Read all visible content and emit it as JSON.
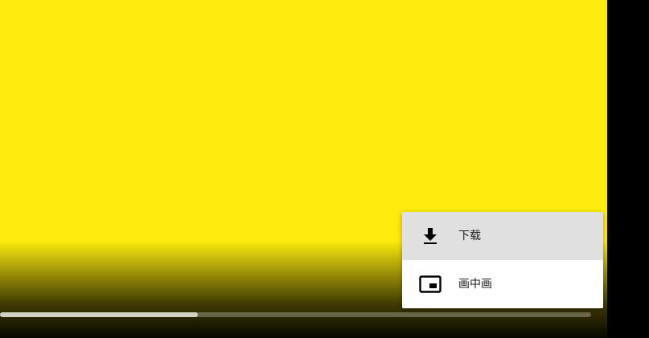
{
  "video": {
    "frame_color": "#FCEB0C"
  },
  "timeline": {
    "progress": 0.335
  },
  "menu": {
    "items": [
      {
        "label": "下载",
        "icon": "download-icon",
        "highlighted": true
      },
      {
        "label": "画中画",
        "icon": "picture-in-picture-icon",
        "highlighted": false
      }
    ]
  }
}
